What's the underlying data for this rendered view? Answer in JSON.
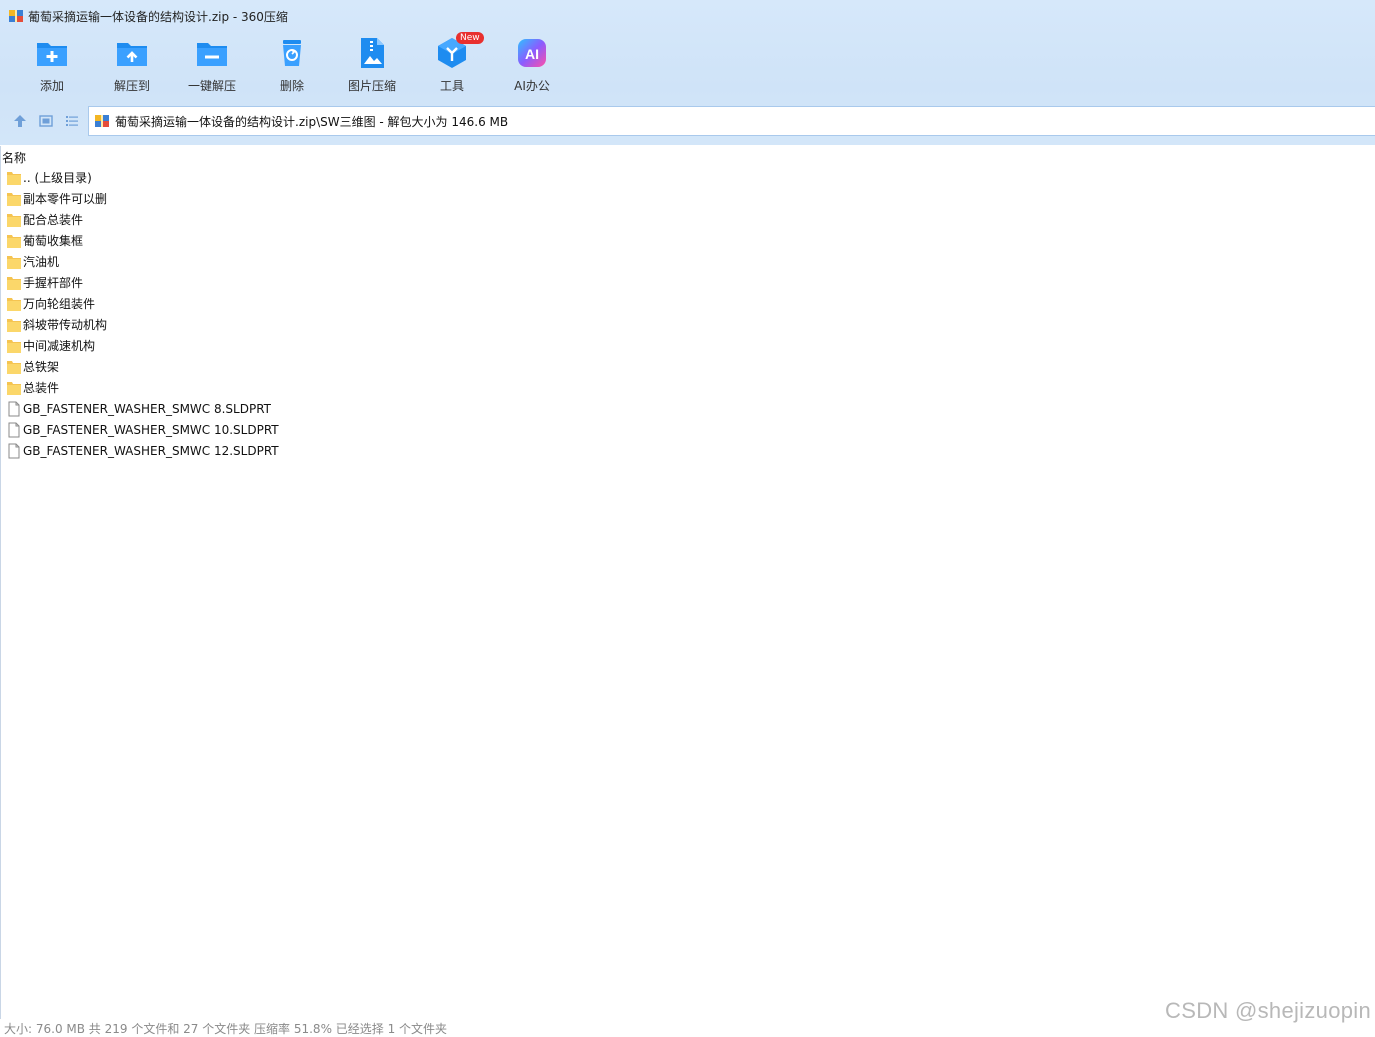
{
  "window": {
    "title": "葡萄采摘运输一体设备的结构设计.zip - 360压缩",
    "app_icon": "archive-icon"
  },
  "toolbar": {
    "items": [
      {
        "label": "添加",
        "icon": "add-folder-icon"
      },
      {
        "label": "解压到",
        "icon": "extract-folder-icon"
      },
      {
        "label": "一键解压",
        "icon": "quick-extract-icon"
      },
      {
        "label": "删除",
        "icon": "recycle-delete-icon"
      },
      {
        "label": "图片压缩",
        "icon": "image-compress-icon"
      },
      {
        "label": "工具",
        "icon": "tools-cube-icon",
        "badge": "New"
      },
      {
        "label": "AI办公",
        "icon": "ai-office-icon"
      }
    ],
    "accent": "#1e8cf0",
    "badge_color": "#e8302f"
  },
  "address_bar": {
    "path": "葡萄采摘运输一体设备的结构设计.zip\\SW三维图 - 解包大小为 146.6 MB",
    "nav_icons": [
      "up-arrow-icon",
      "thumbnail-view-icon",
      "list-view-icon"
    ]
  },
  "file_list": {
    "column_header": "名称",
    "rows": [
      {
        "name": ".. (上级目录)",
        "type": "folder"
      },
      {
        "name": "副本零件可以删",
        "type": "folder"
      },
      {
        "name": "配合总装件",
        "type": "folder"
      },
      {
        "name": "葡萄收集框",
        "type": "folder"
      },
      {
        "name": "汽油机",
        "type": "folder"
      },
      {
        "name": "手握杆部件",
        "type": "folder"
      },
      {
        "name": "万向轮组装件",
        "type": "folder"
      },
      {
        "name": "斜坡带传动机构",
        "type": "folder"
      },
      {
        "name": "中间减速机构",
        "type": "folder"
      },
      {
        "name": "总铁架",
        "type": "folder"
      },
      {
        "name": "总装件",
        "type": "folder"
      },
      {
        "name": "GB_FASTENER_WASHER_SMWC 8.SLDPRT",
        "type": "file"
      },
      {
        "name": "GB_FASTENER_WASHER_SMWC 10.SLDPRT",
        "type": "file"
      },
      {
        "name": "GB_FASTENER_WASHER_SMWC 12.SLDPRT",
        "type": "file"
      }
    ]
  },
  "status_bar": {
    "text": "大小: 76.0 MB 共 219 个文件和 27 个文件夹 压缩率 51.8% 已经选择 1 个文件夹"
  },
  "watermark": "CSDN @shejizuopin"
}
